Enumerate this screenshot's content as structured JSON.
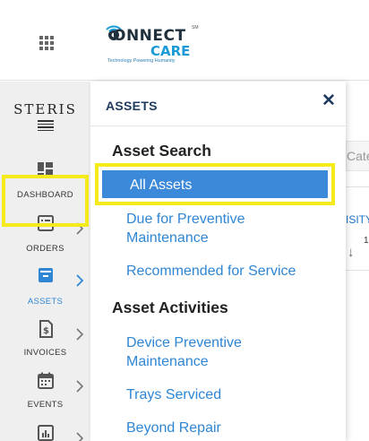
{
  "brand": {
    "connect": "ONNECT",
    "sm": "SM",
    "care": "CARE",
    "tagline": "Technology Powering Humanity",
    "sidebar_logo": "STERIS"
  },
  "sidebar": {
    "items": [
      {
        "label": "DASHBOARD",
        "icon": "dashboard-icon"
      },
      {
        "label": "ORDERS",
        "icon": "orders-icon"
      },
      {
        "label": "ASSETS",
        "icon": "assets-icon"
      },
      {
        "label": "INVOICES",
        "icon": "invoices-icon"
      },
      {
        "label": "EVENTS",
        "icon": "events-icon"
      }
    ]
  },
  "panel": {
    "title": "ASSETS",
    "sections": [
      {
        "heading": "Asset Search",
        "links": [
          "All Assets",
          "Due for Preventive Maintenance",
          "Recommended for Service"
        ]
      },
      {
        "heading": "Asset Activities",
        "links": [
          "Device Preventive Maintenance",
          "Trays Serviced",
          "Beyond Repair"
        ]
      }
    ]
  },
  "background": {
    "search_partial": "Cate",
    "column_partial": "ISITY",
    "sort_value": "1"
  },
  "colors": {
    "accent": "#3b89d8",
    "link": "#2e86d4",
    "highlight": "#f5ea1a",
    "title": "#1f3a5f"
  }
}
